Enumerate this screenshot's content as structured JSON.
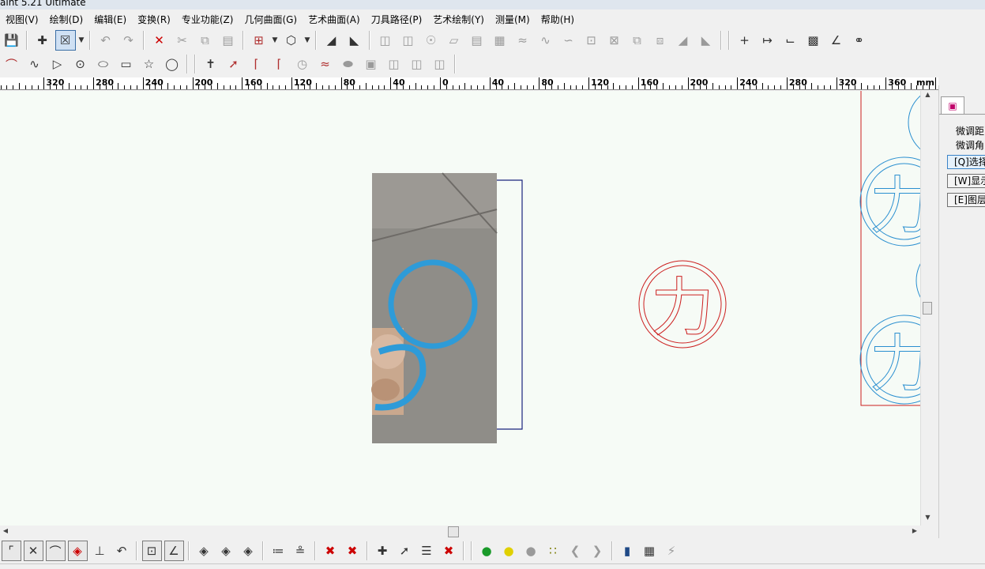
{
  "window": {
    "title": "aint 5.21 Ultimate"
  },
  "menu": [
    {
      "id": "view",
      "label": "视图(V)"
    },
    {
      "id": "draw",
      "label": "绘制(D)"
    },
    {
      "id": "edit",
      "label": "编辑(E)"
    },
    {
      "id": "transform",
      "label": "变换(R)"
    },
    {
      "id": "special",
      "label": "专业功能(Z)"
    },
    {
      "id": "surface",
      "label": "几何曲面(G)"
    },
    {
      "id": "art-surface",
      "label": "艺术曲面(A)"
    },
    {
      "id": "toolpath",
      "label": "刀具路径(P)"
    },
    {
      "id": "art-draw",
      "label": "艺术绘制(Y)"
    },
    {
      "id": "measure",
      "label": "测量(M)"
    },
    {
      "id": "help",
      "label": "帮助(H)"
    }
  ],
  "ruler": {
    "unit": "mm",
    "labels": [
      "320",
      "280",
      "240",
      "200",
      "160",
      "120",
      "80",
      "40",
      "0",
      "40",
      "80",
      "120",
      "160",
      "200",
      "240",
      "280",
      "320",
      "360"
    ]
  },
  "canvas": {
    "reference_photo": {
      "description": "photo",
      "disc_color": "#2e9bd8"
    },
    "stamp": {
      "glyph": "力",
      "stroke_color": "#cc1f1f"
    },
    "toolpath_preview": {
      "glyph": "力",
      "stroke_color": "#2a8fd0",
      "border_color": "#cc1f1f"
    },
    "frame_color": "#1a237e"
  },
  "right_panel": {
    "labels": {
      "fine_distance": "微调距",
      "fine_angle": "微调角"
    },
    "buttons": {
      "select": "[Q]选择",
      "display": "[W]显示",
      "layer": "[E]图层"
    }
  },
  "colors": {
    "canvas_bg": "#f6fbf6",
    "accent": "#3a6ea5"
  }
}
